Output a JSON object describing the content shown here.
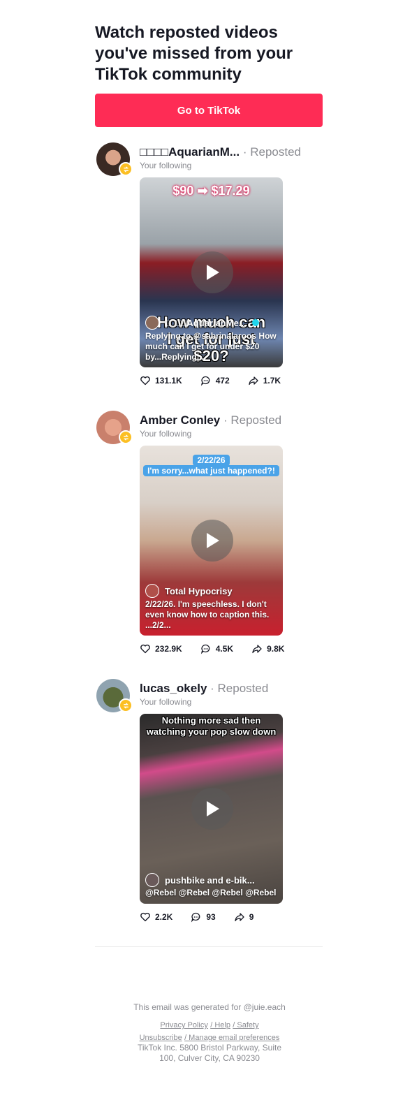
{
  "headline": "Watch reposted videos you've missed from your TikTok community",
  "cta_label": "Go to TikTok",
  "posts": [
    {
      "username": "□□□□AquarianM...",
      "reposted": "· Reposted",
      "following": "Your following",
      "overlay_top": "$90 ➡ $17.29",
      "overlay_mid": "How much can I get for just $20?",
      "creator": "□□□□AquarianMe...",
      "caption": "Replying to @sabrinalaroos How much can I get for under $20 by...Replying...",
      "likes": "131.1K",
      "comments": "472",
      "shares": "1.7K"
    },
    {
      "username": "Amber Conley",
      "reposted": "· Reposted",
      "following": "Your following",
      "overlay_date": "2/22/26",
      "overlay_top": "I'm sorry...what just happened?!",
      "creator": "Total Hypocrisy",
      "caption": "2/22/26. I'm speechless. I don't even know how to caption this. ...2/2...",
      "likes": "232.9K",
      "comments": "4.5K",
      "shares": "9.8K"
    },
    {
      "username": "lucas_okely",
      "reposted": "· Reposted",
      "following": "Your following",
      "overlay_top": "Nothing more sad then watching your pop slow down",
      "creator": "pushbike and e-bik...",
      "caption": "@Rebel @Rebel @Rebel @Rebel",
      "likes": "2.2K",
      "comments": "93",
      "shares": "9"
    }
  ],
  "footer": {
    "generated_for": "This email was generated for @juie.each",
    "privacy": "Privacy Policy",
    "help": "/ Help",
    "safety": "/ Safety",
    "unsubscribe": "Unsubscribe",
    "manage": "/ Manage email preferences",
    "address": "TikTok Inc. 5800 Bristol Parkway, Suite 100, Culver City, CA 90230"
  },
  "colors": {
    "brand": "#fe2c55",
    "repost_badge": "#fcbf23",
    "muted": "#8a8b91"
  },
  "icons": [
    "repost-icon",
    "play-icon",
    "heart-icon",
    "comment-icon",
    "share-icon",
    "verified-icon"
  ]
}
